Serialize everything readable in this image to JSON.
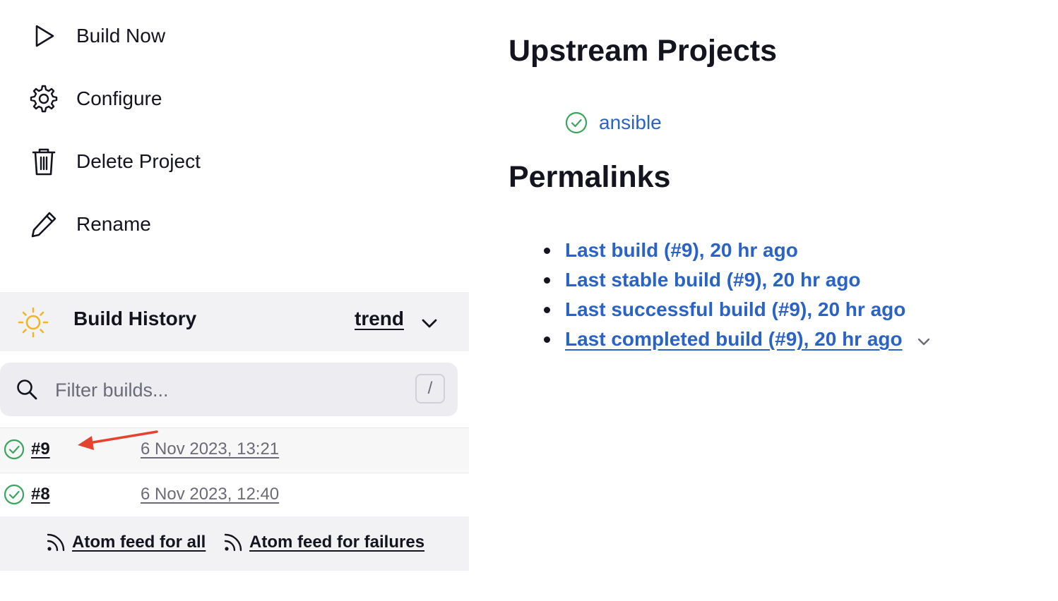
{
  "tasks": [
    {
      "label": "Build Now",
      "icon": "play-icon"
    },
    {
      "label": "Configure",
      "icon": "gear-icon"
    },
    {
      "label": "Delete Project",
      "icon": "trash-icon"
    },
    {
      "label": "Rename",
      "icon": "pencil-icon"
    }
  ],
  "build_history": {
    "title": "Build History",
    "trend_label": "trend",
    "filter_placeholder": "Filter builds...",
    "filter_shortcut": "/",
    "builds": [
      {
        "number": "#9",
        "date": "6 Nov 2023, 13:21",
        "status": "success"
      },
      {
        "number": "#8",
        "date": "6 Nov 2023, 12:40",
        "status": "success"
      }
    ],
    "feeds": [
      {
        "label": "Atom feed for all"
      },
      {
        "label": "Atom feed for failures"
      }
    ]
  },
  "upstream": {
    "heading": "Upstream Projects",
    "projects": [
      {
        "name": "ansible",
        "status": "success"
      }
    ]
  },
  "permalinks": {
    "heading": "Permalinks",
    "items": [
      {
        "label": "Last build (#9), 20 hr ago"
      },
      {
        "label": "Last stable build (#9), 20 hr ago"
      },
      {
        "label": "Last successful build (#9), 20 hr ago"
      },
      {
        "label": "Last completed build (#9), 20 hr ago"
      }
    ]
  },
  "colors": {
    "link": "#2a63c7",
    "success": "#3aa55d",
    "annotation_arrow": "#e4432d",
    "panel": "#f2f2f5",
    "sun": "#f0b429"
  }
}
